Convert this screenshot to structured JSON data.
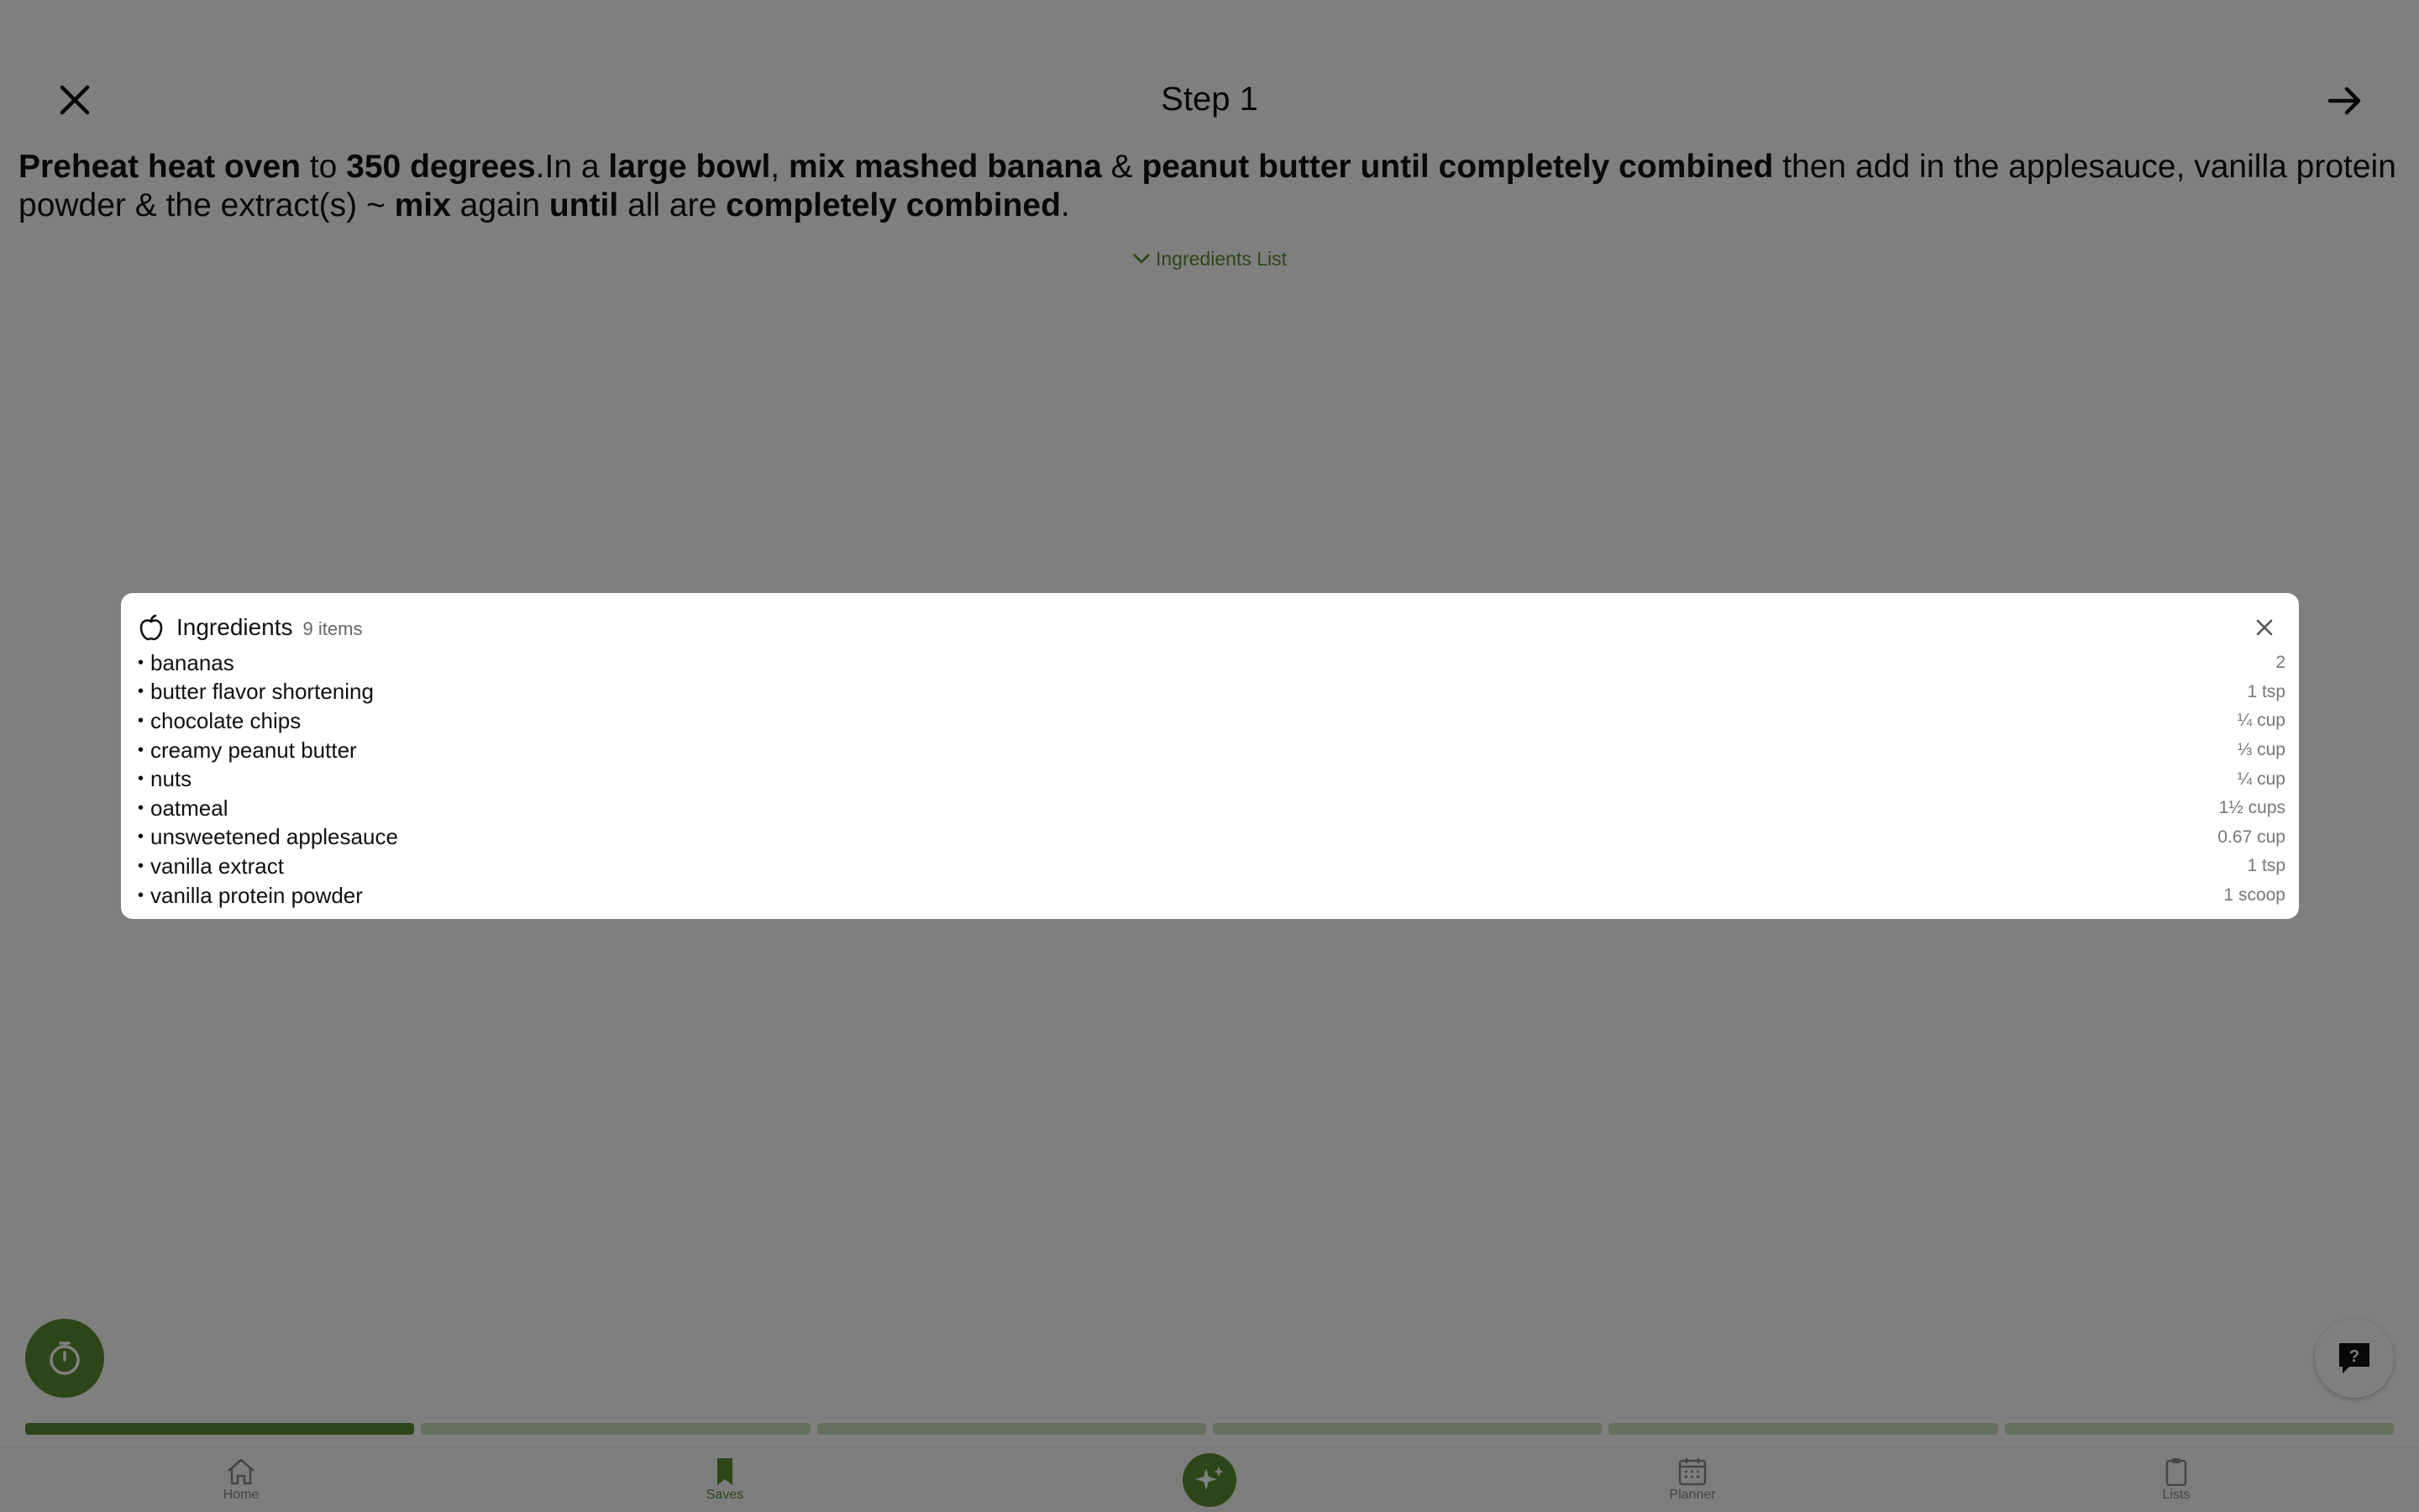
{
  "header": {
    "title": "Step 1"
  },
  "instruction": [
    {
      "t": "Preheat heat oven",
      "b": true
    },
    {
      "t": " to ",
      "b": false
    },
    {
      "t": "350 degrees",
      "b": true
    },
    {
      "t": ".In a ",
      "b": false
    },
    {
      "t": "large bowl",
      "b": true
    },
    {
      "t": ", ",
      "b": false
    },
    {
      "t": "mix mashed banana",
      "b": true
    },
    {
      "t": " & ",
      "b": false
    },
    {
      "t": "peanut butter until completely combined",
      "b": true
    },
    {
      "t": " then add in the applesauce, vanilla protein powder & the extract(s) ~ ",
      "b": false
    },
    {
      "t": "mix",
      "b": true
    },
    {
      "t": " again ",
      "b": false
    },
    {
      "t": "until",
      "b": true
    },
    {
      "t": " all are ",
      "b": false
    },
    {
      "t": "completely combined",
      "b": true
    },
    {
      "t": ".",
      "b": false
    }
  ],
  "ingredients_toggle": {
    "label": "Ingredients List",
    "icon": "chevron-down-icon"
  },
  "modal": {
    "title": "Ingredients",
    "count": "9 items",
    "items": [
      {
        "name": "bananas",
        "qty": "2"
      },
      {
        "name": "butter flavor shortening",
        "qty": "1 tsp"
      },
      {
        "name": "chocolate chips",
        "qty": "¼ cup"
      },
      {
        "name": "creamy peanut butter",
        "qty": "⅓ cup"
      },
      {
        "name": "nuts",
        "qty": "¼ cup"
      },
      {
        "name": "oatmeal",
        "qty": "1½ cups"
      },
      {
        "name": "unsweetened applesauce",
        "qty": "0.67 cup"
      },
      {
        "name": "vanilla extract",
        "qty": "1 tsp"
      },
      {
        "name": "vanilla protein powder",
        "qty": "1 scoop"
      }
    ]
  },
  "progress": {
    "total_steps": 6,
    "current_step": 1
  },
  "tabbar": {
    "home": "Home",
    "saves": "Saves",
    "planner": "Planner",
    "lists": "Lists"
  },
  "colors": {
    "accent": "#5a8d2e",
    "accent_light": "#cde0bd",
    "overlay": "rgba(0,0,0,0.5)"
  }
}
